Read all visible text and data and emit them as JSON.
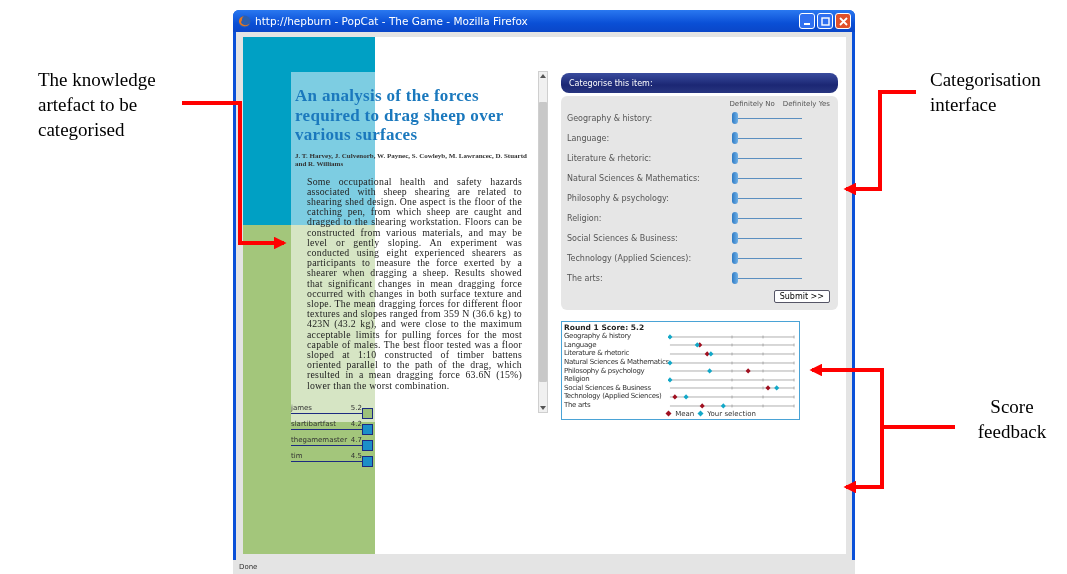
{
  "annotations": [
    {
      "kind": "left",
      "text": "The knowledge artefact to be categorised"
    },
    {
      "kind": "topright",
      "text": "Categorisation interface"
    },
    {
      "kind": "bottomright",
      "text": "Score feedback"
    }
  ],
  "window": {
    "title": "http://hepburn - PopCat - The Game - Mozilla Firefox"
  },
  "article": {
    "title": "An analysis of the forces required to drag sheep over various surfaces",
    "authors": "J. T. Harvey, J. Culvenorb, W. Paynec, S. Cowleyb, M. Lawrancec, D. Stuartd and R. Williams",
    "abstract": "Some occupational health and safety hazards associated with sheep shearing are related to shearing shed design. One aspect is the floor of the catching pen, from which sheep are caught and dragged to the shearing workstation. Floors can be constructed from various materials, and may be level or gently sloping. An experiment was conducted using eight experienced shearers as participants to measure the force exerted by a shearer when dragging a sheep. Results showed that significant changes in mean dragging force occurred with changes in both surface texture and slope. The mean dragging forces for different floor textures and slopes ranged from 359 N (36.6 kg) to 423N (43.2 kg), and were close to the maximum acceptable limits for pulling forces for the most capable of males. The best floor tested was a floor sloped at 1:10 constructed of timber battens oriented parallel to the path of the drag, which resulted in a mean dragging force 63.6N (15%) lower than the worst combination."
  },
  "leaderboard": [
    {
      "name": "james",
      "score": "5.2",
      "color": "#9dc07a"
    },
    {
      "name": "slartibartfast",
      "score": "4.2",
      "color": "#1b8fc8"
    },
    {
      "name": "thegamemaster",
      "score": "4.7",
      "color": "#1b8fc8"
    },
    {
      "name": "tim",
      "score": "4.5",
      "color": "#1b8fc8"
    }
  ],
  "categorise": {
    "header": "Categorise this item:",
    "scale_low": "Definitely No",
    "scale_high": "Definitely Yes",
    "submit": "Submit >>",
    "categories": [
      {
        "label": "Geography & history:",
        "level": 0
      },
      {
        "label": "Language:",
        "level": 0
      },
      {
        "label": "Literature & rhetoric:",
        "level": 0
      },
      {
        "label": "Natural Sciences & Mathematics:",
        "level": 0
      },
      {
        "label": "Philosophy & psychology:",
        "level": 0
      },
      {
        "label": "Religion:",
        "level": 0
      },
      {
        "label": "Social Sciences & Business:",
        "level": 0
      },
      {
        "label": "Technology (Applied Sciences):",
        "level": 0
      },
      {
        "label": "The arts:",
        "level": 0
      }
    ]
  },
  "score": {
    "title": "Round 1 Score: 5.2",
    "rows": [
      "Geography & history",
      "Language",
      "Literature & rhetoric",
      "Natural Sciences & Mathematics",
      "Philosophy & psychology",
      "Religion",
      "Social Sciences & Business",
      "Technology (Applied Sciences)",
      "The arts"
    ],
    "legend_mean": "Mean",
    "legend_selection": "Your selection"
  },
  "status_bar": "Done"
}
